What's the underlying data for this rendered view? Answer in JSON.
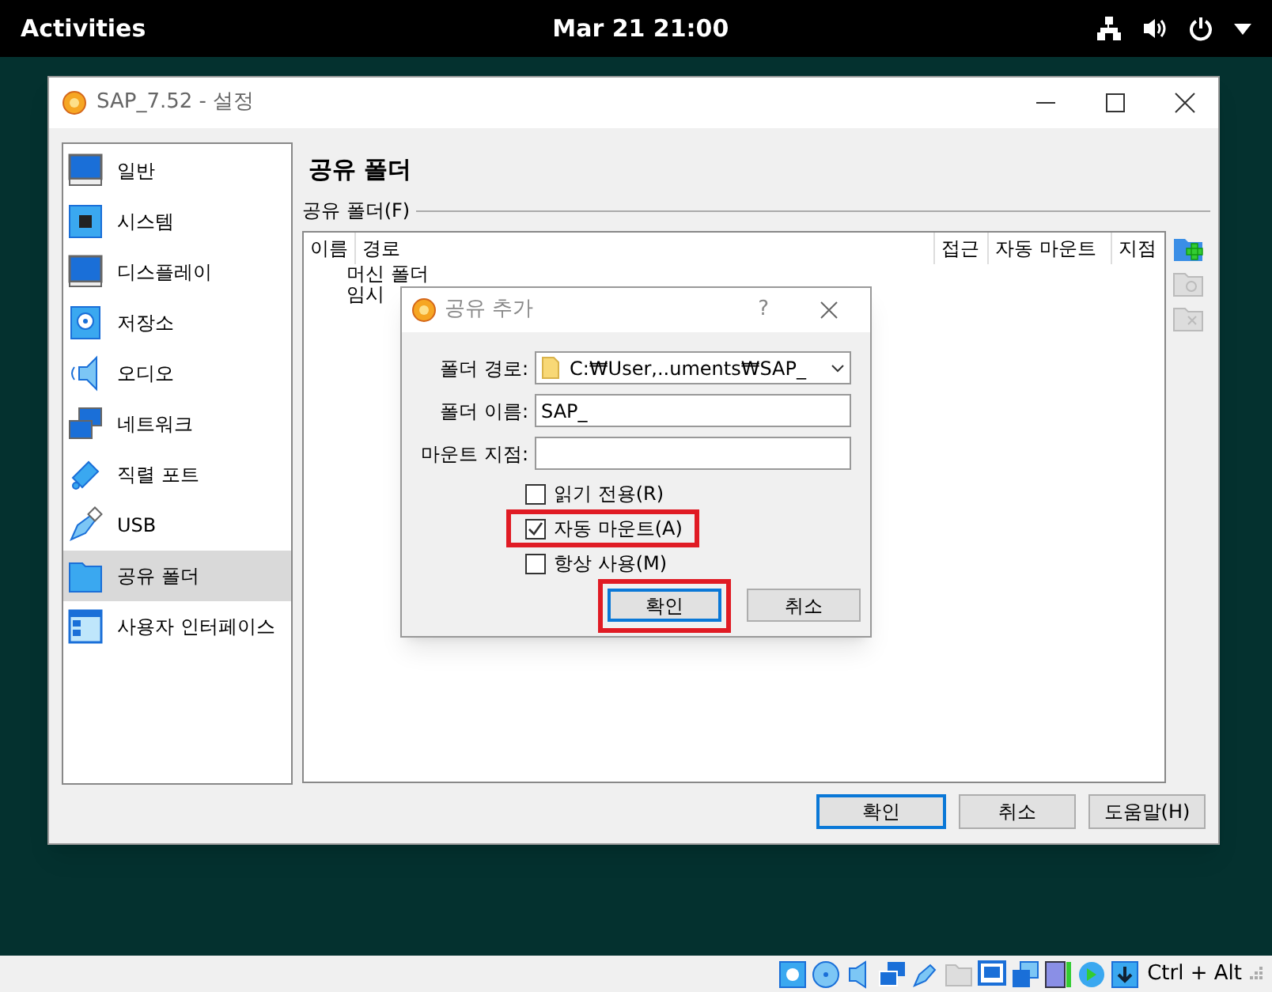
{
  "topbar": {
    "activities": "Activities",
    "clock": "Mar 21  21:00"
  },
  "window": {
    "title": "SAP_7.52 - 설정"
  },
  "sidebar": {
    "items": [
      {
        "label": "일반",
        "selected": false
      },
      {
        "label": "시스템",
        "selected": false
      },
      {
        "label": "디스플레이",
        "selected": false
      },
      {
        "label": "저장소",
        "selected": false
      },
      {
        "label": "오디오",
        "selected": false
      },
      {
        "label": "네트워크",
        "selected": false
      },
      {
        "label": "직렬 포트",
        "selected": false
      },
      {
        "label": "USB",
        "selected": false
      },
      {
        "label": "공유 폴더",
        "selected": true
      },
      {
        "label": "사용자 인터페이스",
        "selected": false
      }
    ]
  },
  "page": {
    "heading": "공유 폴더",
    "group_label": "공유 폴더(F)",
    "table": {
      "columns": [
        "이름",
        "경로",
        "접근",
        "자동 마운트",
        "지점"
      ],
      "rows": [
        {
          "name": "머신 폴더"
        },
        {
          "name": "임시"
        }
      ]
    }
  },
  "buttons": [
    "확인",
    "취소",
    "도움말(H)"
  ],
  "dialog": {
    "title": "공유 추가",
    "help": "?",
    "fields": [
      {
        "label": "폴더 경로:",
        "value": "C:₩User,..uments₩SAP_",
        "kind": "combo"
      },
      {
        "label": "폴더 이름:",
        "value": "SAP_",
        "kind": "text"
      },
      {
        "label": "마운트 지점:",
        "kind": "text"
      }
    ],
    "checkboxes": [
      {
        "label": "읽기 전용(R)",
        "checked": false,
        "highlighted": false
      },
      {
        "label": "자동 마운트(A)",
        "checked": true,
        "highlighted": true
      },
      {
        "label": "항상 사용(M)",
        "checked": false,
        "highlighted": false
      }
    ],
    "buttons": [
      {
        "label": "확인",
        "default": true,
        "highlighted": true
      },
      {
        "label": "취소",
        "default": false,
        "highlighted": false
      }
    ]
  },
  "statusbar": {
    "host_key": "Ctrl + Alt"
  }
}
